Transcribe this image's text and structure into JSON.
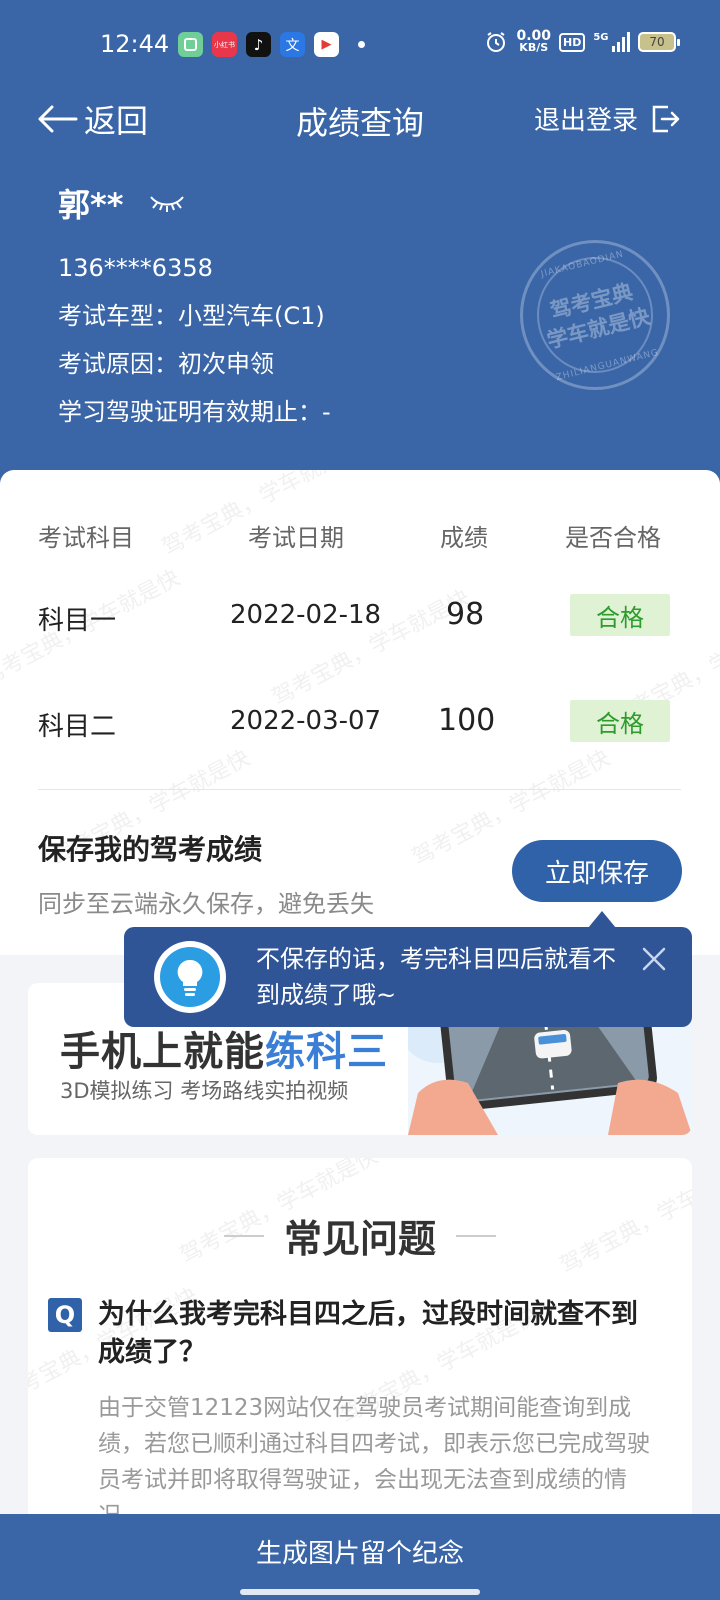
{
  "status_bar": {
    "time": "12:44",
    "apps": [
      {
        "name": "chat-app-icon",
        "label": "",
        "color": "#6fcf97"
      },
      {
        "name": "xiaohongshu-icon",
        "label": "小红书",
        "color": "#e8374a"
      },
      {
        "name": "tiktok-icon",
        "label": "♪",
        "color": "#111111"
      },
      {
        "name": "translate-app-icon",
        "label": "文",
        "color": "#2b78e4"
      },
      {
        "name": "video-app-icon",
        "label": "▶",
        "color": "#ffffff"
      }
    ],
    "net_speed": "0.00",
    "net_unit": "KB/S",
    "hd": "HD",
    "signal": "5G",
    "battery": "70"
  },
  "nav": {
    "back_label": "返回",
    "title": "成绩查询",
    "logout_label": "退出登录"
  },
  "profile": {
    "name": "郭**",
    "phone": "136****6358",
    "vehicle_type": "考试车型：小型汽车(C1)",
    "exam_reason": "考试原因：初次申领",
    "permit_expiry": "学习驾驶证明有效期止：-"
  },
  "stamp": {
    "line1": "驾考宝典",
    "line2": "学车就是快",
    "arc_top": "JIAKAOBAODIAN",
    "arc_bottom": "ZHILIANGUANWANG"
  },
  "score_table": {
    "headers": [
      "考试科目",
      "考试日期",
      "成绩",
      "是否合格"
    ],
    "rows": [
      {
        "subject": "科目一",
        "date": "2022-02-18",
        "score": "98",
        "status": "合格"
      },
      {
        "subject": "科目二",
        "date": "2022-03-07",
        "score": "100",
        "status": "合格"
      }
    ]
  },
  "save_section": {
    "title": "保存我的驾考成绩",
    "subtitle": "同步至云端永久保存，避免丢失",
    "button": "立即保存"
  },
  "tooltip": {
    "text": "不保存的话，考完科目四后就看不到成绩了哦~"
  },
  "banner": {
    "title_prefix": "手机上就能",
    "title_highlight": "练科三",
    "subtitle": "3D模拟练习 考场路线实拍视频"
  },
  "faq": {
    "title": "常见问题",
    "question": "为什么我考完科目四之后，过段时间就查不到成绩了？",
    "answer": "由于交管12123网站仅在驾驶员考试期间能查询到成绩，若您已顺利通过科目四考试，即表示您已完成驾驶员考试并即将取得驾驶证，会出现无法查到成绩的情况。",
    "q_marker": "Q"
  },
  "watermark": "驾考宝典，学车就是快",
  "bottom_action": "生成图片留个纪念",
  "colors": {
    "primary": "#3a66a8",
    "button": "#2f62a8",
    "pass_bg": "#dff3d4",
    "pass_text": "#2f9b2f",
    "highlight": "#3a7fd5"
  }
}
